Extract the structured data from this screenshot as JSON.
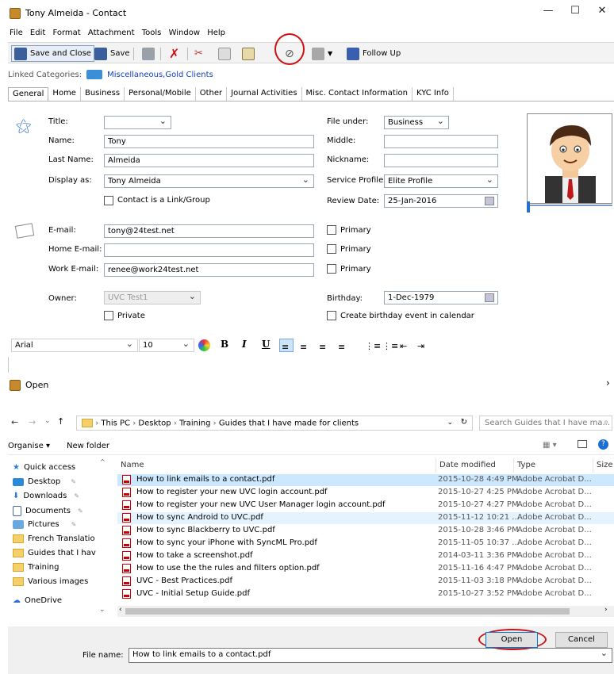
{
  "contact": {
    "title": "Tony Almeida - Contact",
    "menu": [
      "File",
      "Edit",
      "Format",
      "Attachment",
      "Tools",
      "Window",
      "Help"
    ],
    "toolbar": {
      "save_close": "Save and Close",
      "save": "Save",
      "follow_up": "Follow Up"
    },
    "linked_label": "Linked Categories:",
    "linked_value": "Miscellaneous,Gold Clients",
    "tabs": [
      "General",
      "Home",
      "Business",
      "Personal/Mobile",
      "Other",
      "Journal Activities",
      "Misc. Contact Information",
      "KYC Info"
    ],
    "fields": {
      "title_label": "Title:",
      "title_value": "",
      "name_label": "Name:",
      "name_value": "Tony",
      "last_label": "Last Name:",
      "last_value": "Almeida",
      "display_label": "Display as:",
      "display_value": "Tony Almeida",
      "link_group_label": "Contact is a Link/Group",
      "file_under_label": "File under:",
      "file_under_value": "Business",
      "middle_label": "Middle:",
      "middle_value": "",
      "nickname_label": "Nickname:",
      "nickname_value": "",
      "service_label": "Service Profile:",
      "service_value": "Elite Profile",
      "review_label": "Review Date:",
      "review_value": "25-Jan-2016",
      "email_label": "E-mail:",
      "email_value": "tony@24test.net",
      "home_email_label": "Home E-mail:",
      "home_email_value": "",
      "work_email_label": "Work E-mail:",
      "work_email_value": "renee@work24test.net",
      "primary_label": "Primary",
      "owner_label": "Owner:",
      "owner_value": "UVC Test1",
      "private_label": "Private",
      "birthday_label": "Birthday:",
      "birthday_value": "1-Dec-1979",
      "birthday_event_label": "Create birthday event in calendar"
    },
    "format": {
      "font": "Arial",
      "size": "10",
      "bold": "B",
      "italic": "I",
      "underline": "U"
    }
  },
  "open": {
    "title": "Open",
    "breadcrumb": [
      "This PC",
      "Desktop",
      "Training",
      "Guides that I have made for clients"
    ],
    "search_placeholder": "Search Guides that I have ma...",
    "organise": "Organise ▾",
    "new_folder": "New folder",
    "nav": [
      "Quick access",
      "Desktop",
      "Downloads",
      "Documents",
      "Pictures",
      "French Translatio",
      "Guides that I hav",
      "Training",
      "Various images",
      "OneDrive"
    ],
    "columns": {
      "name": "Name",
      "date": "Date modified",
      "type": "Type",
      "size": "Size"
    },
    "files": [
      {
        "name": "How to link emails to a contact.pdf",
        "date": "2015-10-28 4:49 PM",
        "type": "Adobe Acrobat D..."
      },
      {
        "name": "How to register your new UVC login account.pdf",
        "date": "2015-10-27 4:25 PM",
        "type": "Adobe Acrobat D..."
      },
      {
        "name": "How to register your new UVC User Manager login account.pdf",
        "date": "2015-10-27 4:27 PM",
        "type": "Adobe Acrobat D..."
      },
      {
        "name": "How to sync Android to UVC.pdf",
        "date": "2015-11-12 10:21 ...",
        "type": "Adobe Acrobat D..."
      },
      {
        "name": "How to sync Blackberry to UVC.pdf",
        "date": "2015-10-28 3:46 PM",
        "type": "Adobe Acrobat D..."
      },
      {
        "name": "How to sync your iPhone with SyncML Pro.pdf",
        "date": "2015-11-05 10:37 ...",
        "type": "Adobe Acrobat D..."
      },
      {
        "name": "How to take a screenshot.pdf",
        "date": "2014-03-11 3:36 PM",
        "type": "Adobe Acrobat D..."
      },
      {
        "name": "How to use the the rules and filters option.pdf",
        "date": "2015-11-16 4:47 PM",
        "type": "Adobe Acrobat D..."
      },
      {
        "name": "UVC - Best Practices.pdf",
        "date": "2015-11-03 3:18 PM",
        "type": "Adobe Acrobat D..."
      },
      {
        "name": "UVC - Initial Setup Guide.pdf",
        "date": "2015-10-27 3:52 PM",
        "type": "Adobe Acrobat D..."
      }
    ],
    "filename_label": "File name:",
    "filename_value": "How to link emails to a contact.pdf",
    "open_btn": "Open",
    "cancel_btn": "Cancel"
  }
}
